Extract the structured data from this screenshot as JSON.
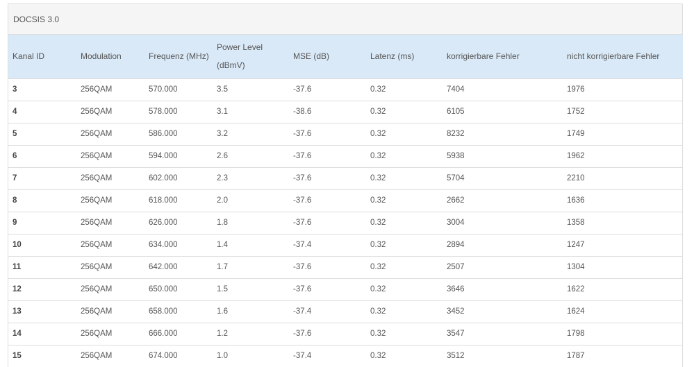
{
  "panel": {
    "title": "DOCSIS 3.0"
  },
  "table": {
    "headers": [
      "Kanal ID",
      "Modulation",
      "Frequenz (MHz)",
      "Power Level (dBmV)",
      "MSE (dB)",
      "Latenz (ms)",
      "korrigierbare Fehler",
      "nicht korrigierbare Fehler"
    ],
    "rows": [
      [
        "3",
        "256QAM",
        "570.000",
        "3.5",
        "-37.6",
        "0.32",
        "7404",
        "1976"
      ],
      [
        "4",
        "256QAM",
        "578.000",
        "3.1",
        "-38.6",
        "0.32",
        "6105",
        "1752"
      ],
      [
        "5",
        "256QAM",
        "586.000",
        "3.2",
        "-37.6",
        "0.32",
        "8232",
        "1749"
      ],
      [
        "6",
        "256QAM",
        "594.000",
        "2.6",
        "-37.6",
        "0.32",
        "5938",
        "1962"
      ],
      [
        "7",
        "256QAM",
        "602.000",
        "2.3",
        "-37.6",
        "0.32",
        "5704",
        "2210"
      ],
      [
        "8",
        "256QAM",
        "618.000",
        "2.0",
        "-37.6",
        "0.32",
        "2662",
        "1636"
      ],
      [
        "9",
        "256QAM",
        "626.000",
        "1.8",
        "-37.6",
        "0.32",
        "3004",
        "1358"
      ],
      [
        "10",
        "256QAM",
        "634.000",
        "1.4",
        "-37.4",
        "0.32",
        "2894",
        "1247"
      ],
      [
        "11",
        "256QAM",
        "642.000",
        "1.7",
        "-37.6",
        "0.32",
        "2507",
        "1304"
      ],
      [
        "12",
        "256QAM",
        "650.000",
        "1.5",
        "-37.6",
        "0.32",
        "3646",
        "1622"
      ],
      [
        "13",
        "256QAM",
        "658.000",
        "1.6",
        "-37.4",
        "0.32",
        "3452",
        "1624"
      ],
      [
        "14",
        "256QAM",
        "666.000",
        "1.2",
        "-37.6",
        "0.32",
        "3547",
        "1798"
      ],
      [
        "15",
        "256QAM",
        "674.000",
        "1.0",
        "-37.4",
        "0.32",
        "3512",
        "1787"
      ]
    ]
  },
  "colors": {
    "header_bg": "#d9e9f7",
    "panel_heading_bg": "#f5f5f5",
    "border": "#dddddd",
    "text": "#555555"
  }
}
